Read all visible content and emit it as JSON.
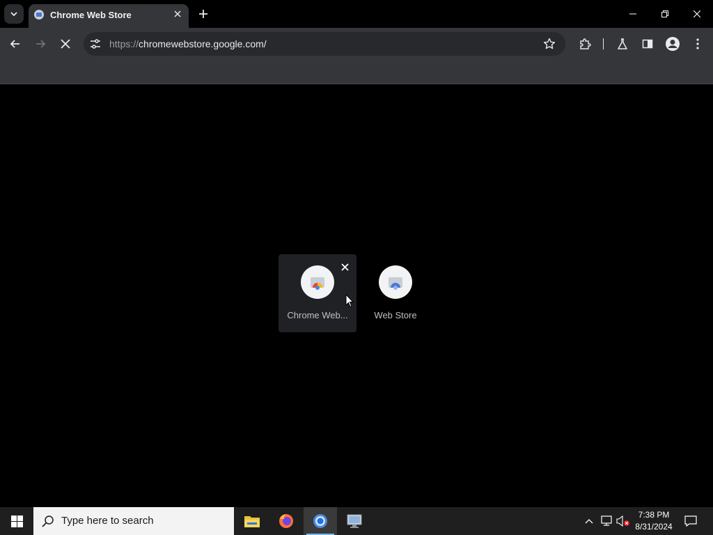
{
  "tab": {
    "title": "Chrome Web Store",
    "close_glyph": "✕"
  },
  "new_tab_glyph": "+",
  "address_bar": {
    "protocol": "https://",
    "host": "chromewebstore.google.com/"
  },
  "shortcuts": [
    {
      "label": "Chrome Web...",
      "icon": "chrome-web-store-icon",
      "hovered": true
    },
    {
      "label": "Web Store",
      "icon": "web-store-icon",
      "hovered": false
    }
  ],
  "taskbar": {
    "search_placeholder": "Type here to search",
    "apps": [
      "file-explorer-icon",
      "firefox-icon",
      "chrome-icon",
      "remote-desktop-icon"
    ],
    "active_app": "chrome-icon",
    "time": "7:38 PM",
    "date": "8/31/2024"
  },
  "colors": {
    "tab_bg": "#35363a",
    "toolbar_bg": "#35363a",
    "page_bg": "#000000",
    "taskbar_bg": "#1f1f1f",
    "accent": "#76b9ed"
  }
}
